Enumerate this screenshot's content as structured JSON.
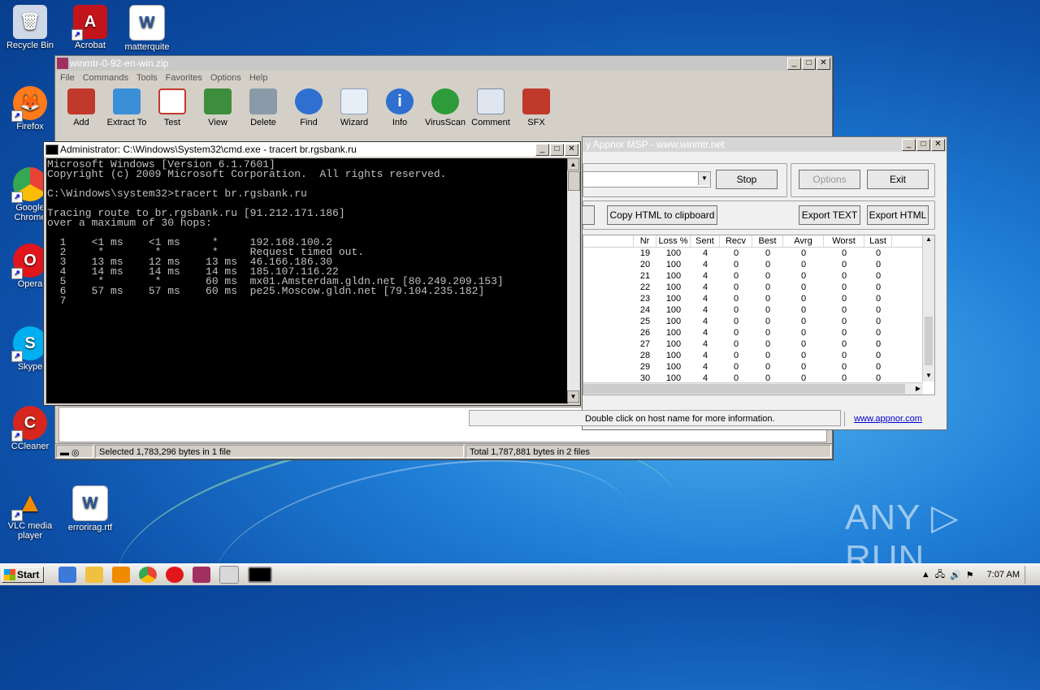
{
  "desktop": {
    "icons": [
      {
        "label": "Recycle Bin",
        "color": "#cfd8e6"
      },
      {
        "label": "Acrobat",
        "color": "#c4141b"
      },
      {
        "label": "matterquite",
        "color": "#2b5797"
      },
      {
        "label": "Firefox",
        "color": "#ff7a1a"
      },
      {
        "label": "Google Chrome",
        "color": "#34a853"
      },
      {
        "label": "Opera",
        "color": "#e0161c"
      },
      {
        "label": "Skype",
        "color": "#00aff0"
      },
      {
        "label": "CCleaner",
        "color": "#d7261e"
      },
      {
        "label": "VLC media player",
        "color": "#f08a00"
      },
      {
        "label": "errorirag.rtf",
        "color": "#2b5797"
      }
    ]
  },
  "winrar": {
    "title": "winmtr-0-92-en-win.zip",
    "menu": [
      "File",
      "Commands",
      "Tools",
      "Favorites",
      "Options",
      "Help"
    ],
    "tools": [
      {
        "label": "Add",
        "color": "#c0392b"
      },
      {
        "label": "Extract To",
        "color": "#3a8fd6"
      },
      {
        "label": "Test",
        "color": "#c0392b"
      },
      {
        "label": "View",
        "color": "#3c8d3c"
      },
      {
        "label": "Delete",
        "color": "#8a9aa8"
      },
      {
        "label": "Find",
        "color": "#2f6fd0"
      },
      {
        "label": "Wizard",
        "color": "#8aa0c0"
      },
      {
        "label": "Info",
        "color": "#2f6fd0"
      },
      {
        "label": "VirusScan",
        "color": "#2e9b3a"
      },
      {
        "label": "Comment",
        "color": "#7a8fa8"
      },
      {
        "label": "SFX",
        "color": "#c0392b"
      }
    ],
    "status_left": "Selected 1,783,296 bytes in 1 file",
    "status_right": "Total 1,787,881 bytes in 2 files"
  },
  "cmd": {
    "title": "Administrator: C:\\Windows\\System32\\cmd.exe - tracert  br.rgsbank.ru",
    "lines": [
      "Microsoft Windows [Version 6.1.7601]",
      "Copyright (c) 2009 Microsoft Corporation.  All rights reserved.",
      "",
      "C:\\Windows\\system32>tracert br.rgsbank.ru",
      "",
      "Tracing route to br.rgsbank.ru [91.212.171.186]",
      "over a maximum of 30 hops:",
      "",
      "  1    <1 ms    <1 ms     *     192.168.100.2",
      "  2     *        *        *     Request timed out.",
      "  3    13 ms    12 ms    13 ms  46.166.186.30",
      "  4    14 ms    14 ms    14 ms  185.107.116.22",
      "  5     *        *       60 ms  mx01.Amsterdam.gldn.net [80.249.209.153]",
      "  6    57 ms    57 ms    60 ms  pe25.Moscow.gldn.net [79.104.235.182]",
      "  7"
    ]
  },
  "winmtr": {
    "title": "y Appnor MSP - www.winmtr.net",
    "stop": "Stop",
    "options": "Options",
    "exit": "Exit",
    "copy_html": "Copy HTML to clipboard",
    "export_text": "Export TEXT",
    "export_html": "Export HTML",
    "columns": [
      "Nr",
      "Loss %",
      "Sent",
      "Recv",
      "Best",
      "Avrg",
      "Worst",
      "Last"
    ],
    "rows": [
      [
        "19",
        "100",
        "4",
        "0",
        "0",
        "0",
        "0",
        "0"
      ],
      [
        "20",
        "100",
        "4",
        "0",
        "0",
        "0",
        "0",
        "0"
      ],
      [
        "21",
        "100",
        "4",
        "0",
        "0",
        "0",
        "0",
        "0"
      ],
      [
        "22",
        "100",
        "4",
        "0",
        "0",
        "0",
        "0",
        "0"
      ],
      [
        "23",
        "100",
        "4",
        "0",
        "0",
        "0",
        "0",
        "0"
      ],
      [
        "24",
        "100",
        "4",
        "0",
        "0",
        "0",
        "0",
        "0"
      ],
      [
        "25",
        "100",
        "4",
        "0",
        "0",
        "0",
        "0",
        "0"
      ],
      [
        "26",
        "100",
        "4",
        "0",
        "0",
        "0",
        "0",
        "0"
      ],
      [
        "27",
        "100",
        "4",
        "0",
        "0",
        "0",
        "0",
        "0"
      ],
      [
        "28",
        "100",
        "4",
        "0",
        "0",
        "0",
        "0",
        "0"
      ],
      [
        "29",
        "100",
        "4",
        "0",
        "0",
        "0",
        "0",
        "0"
      ],
      [
        "30",
        "100",
        "4",
        "0",
        "0",
        "0",
        "0",
        "0"
      ]
    ],
    "status": "Double click on host name for more information.",
    "link": "www.appnor.com"
  },
  "taskbar": {
    "start": "Start",
    "clock": "7:07 AM"
  },
  "watermark": "ANY ▷ RUN"
}
